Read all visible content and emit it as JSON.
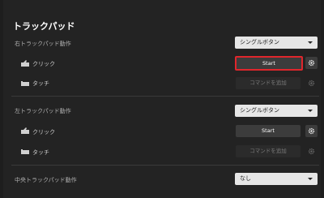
{
  "page": {
    "title": "トラックパッド"
  },
  "right_trackpad": {
    "label": "右トラックパッド動作",
    "mode": "シングルボタン",
    "click_label": "クリック",
    "click_button": "Start",
    "touch_label": "タッチ",
    "touch_button": "コマンドを追加"
  },
  "left_trackpad": {
    "label": "左トラックパッド動作",
    "mode": "シングルボタン",
    "click_label": "クリック",
    "click_button": "Start",
    "touch_label": "タッチ",
    "touch_button": "コマンドを追加"
  },
  "center_trackpad": {
    "label": "中央トラックパッド動作",
    "mode": "なし"
  },
  "colors": {
    "background": "#232323",
    "focus_outline": "#e0262c",
    "dropdown_bg": "#e6e6e6"
  },
  "icons": {
    "click": "trackpad-click-icon",
    "touch": "trackpad-touch-icon",
    "settings": "gear-icon",
    "dropdown": "chevron-down-icon"
  }
}
